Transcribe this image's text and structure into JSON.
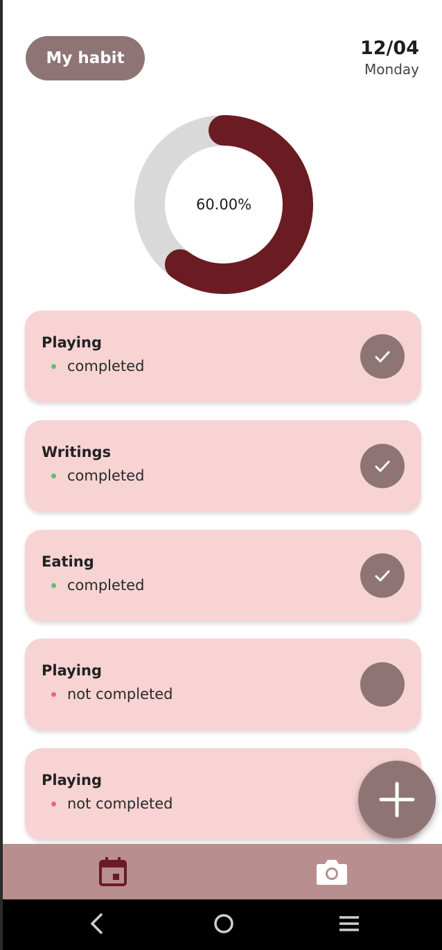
{
  "header": {
    "habit_button_label": "My habit",
    "date": "12/04",
    "weekday": "Monday"
  },
  "progress": {
    "label": "60.00%",
    "fraction": 0.6,
    "fill_color": "#6b1b22",
    "track_color": "#d9d9d9"
  },
  "habits": [
    {
      "name": "Playing",
      "status": "completed",
      "done": true
    },
    {
      "name": "Writings",
      "status": "completed",
      "done": true
    },
    {
      "name": "Eating",
      "status": "completed",
      "done": true
    },
    {
      "name": "Playing",
      "status": "not completed",
      "done": false
    },
    {
      "name": "Playing",
      "status": "not completed",
      "done": false
    }
  ],
  "colors": {
    "accent": "#8f7476",
    "card_bg": "#f7d3d4",
    "nav_bg": "#b98e8f",
    "completed_dot": "#58c26a",
    "not_completed_dot": "#f0647a"
  },
  "icons": {
    "fab": "plus-icon",
    "nav_left": "calendar-icon",
    "nav_right": "camera-icon",
    "system": [
      "back-icon",
      "home-icon",
      "recents-icon"
    ]
  }
}
